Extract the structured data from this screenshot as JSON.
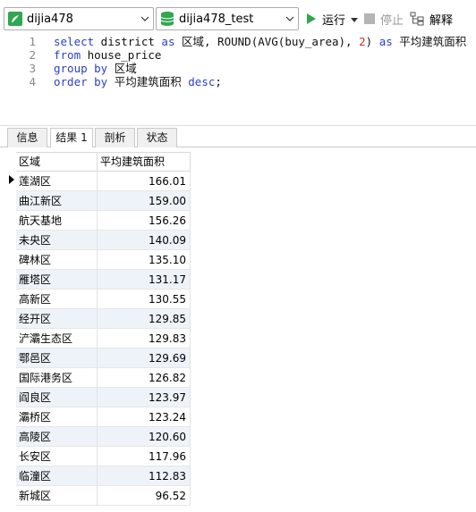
{
  "toolbar": {
    "connection": "dijia478",
    "database": "dijia478_test",
    "run_label": "运行",
    "stop_label": "停止",
    "explain_label": "解释"
  },
  "editor": {
    "line_numbers": [
      "1",
      "2",
      "3",
      "4"
    ],
    "lines": [
      [
        {
          "t": "select",
          "c": "kw"
        },
        {
          "t": " district ",
          "c": "plain"
        },
        {
          "t": "as",
          "c": "kw"
        },
        {
          "t": " 区域, ROUND(AVG(buy_area), ",
          "c": "plain"
        },
        {
          "t": "2",
          "c": "num"
        },
        {
          "t": ") ",
          "c": "plain"
        },
        {
          "t": "as",
          "c": "kw"
        },
        {
          "t": " 平均建筑面积",
          "c": "plain"
        }
      ],
      [
        {
          "t": "from",
          "c": "kw"
        },
        {
          "t": " house_price",
          "c": "plain"
        }
      ],
      [
        {
          "t": "group by",
          "c": "kw"
        },
        {
          "t": " 区域",
          "c": "plain"
        }
      ],
      [
        {
          "t": "order by",
          "c": "kw"
        },
        {
          "t": " 平均建筑面积 ",
          "c": "plain"
        },
        {
          "t": "desc",
          "c": "kw"
        },
        {
          "t": ";",
          "c": "plain"
        }
      ]
    ]
  },
  "tabs": [
    "信息",
    "结果 1",
    "剖析",
    "状态"
  ],
  "active_tab": 1,
  "grid": {
    "columns": [
      "区域",
      "平均建筑面积"
    ],
    "rows": [
      [
        "莲湖区",
        "166.01"
      ],
      [
        "曲江新区",
        "159.00"
      ],
      [
        "航天基地",
        "156.26"
      ],
      [
        "未央区",
        "140.09"
      ],
      [
        "碑林区",
        "135.10"
      ],
      [
        "雁塔区",
        "131.17"
      ],
      [
        "高新区",
        "130.55"
      ],
      [
        "经开区",
        "129.85"
      ],
      [
        "浐灞生态区",
        "129.83"
      ],
      [
        "鄠邑区",
        "129.69"
      ],
      [
        "国际港务区",
        "126.82"
      ],
      [
        "阎良区",
        "123.97"
      ],
      [
        "灞桥区",
        "123.24"
      ],
      [
        "高陵区",
        "120.60"
      ],
      [
        "长安区",
        "117.96"
      ],
      [
        "临潼区",
        "112.83"
      ],
      [
        "新城区",
        "96.52"
      ]
    ]
  },
  "colors": {
    "keyword": "#2e3ec9",
    "number": "#c0392b",
    "run_icon": "#2fa84f",
    "row_alt": "#eef3f9"
  }
}
